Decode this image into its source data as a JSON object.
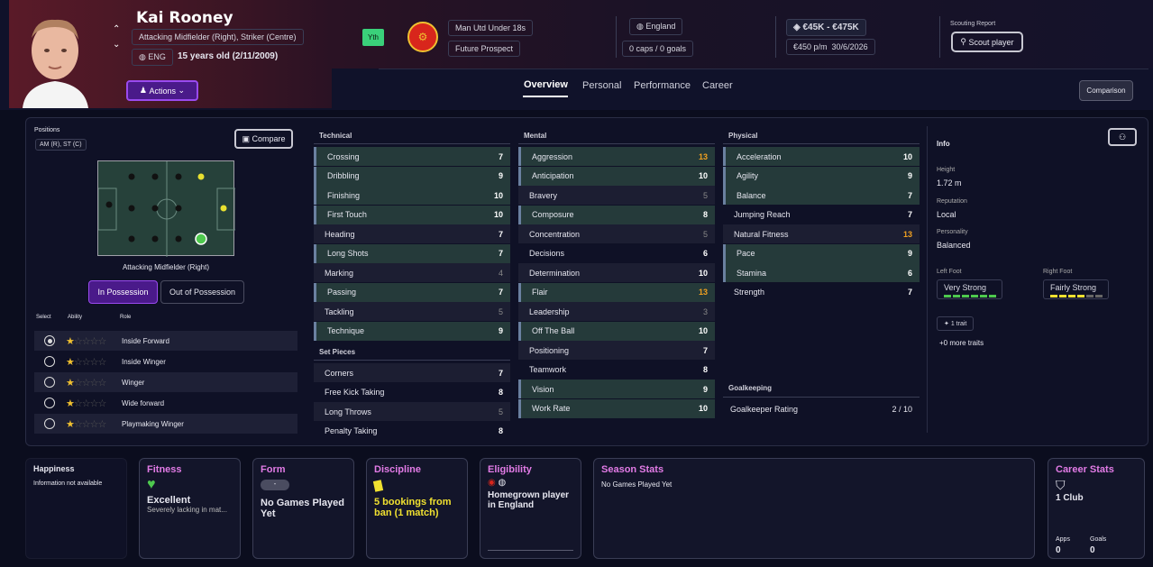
{
  "player": {
    "name": "Kai Rooney",
    "positions_long": "Attacking Midfielder (Right), Striker (Centre)",
    "nation": "ENG",
    "age": "15 years old (2/11/2009)",
    "badge": "Yth",
    "club": "Man Utd Under 18s",
    "status": "Future Prospect",
    "country": "England",
    "caps": "0 caps / 0 goals",
    "value": "€45K - €475K",
    "wage": "€450 p/m",
    "contract": "30/6/2026",
    "scout_label": "Scouting Report",
    "scout_btn": "Scout player",
    "actions": "Actions",
    "comparison": "Comparison"
  },
  "tabs": [
    "Overview",
    "Personal",
    "Performance",
    "Career"
  ],
  "left": {
    "positions_label": "Positions",
    "positions": "AM (R), ST (C)",
    "compare": "Compare",
    "role_caption": "Attacking Midfielder (Right)",
    "in_poss": "In Possession",
    "out_poss": "Out of Possession",
    "col_select": "Select",
    "col_ability": "Ability",
    "col_role": "Role",
    "roles": [
      {
        "name": "Inside Forward",
        "stars": 1
      },
      {
        "name": "Inside Winger",
        "stars": 1
      },
      {
        "name": "Winger",
        "stars": 1
      },
      {
        "name": "Wide forward",
        "stars": 0.5
      },
      {
        "name": "Playmaking Winger",
        "stars": 0.5
      }
    ]
  },
  "technical": {
    "title": "Technical",
    "items": [
      [
        "Crossing",
        "7"
      ],
      [
        "Dribbling",
        "9"
      ],
      [
        "Finishing",
        "10"
      ],
      [
        "First Touch",
        "10"
      ],
      [
        "Heading",
        "7"
      ],
      [
        "Long Shots",
        "7"
      ],
      [
        "Marking",
        "4"
      ],
      [
        "Passing",
        "7"
      ],
      [
        "Tackling",
        "5"
      ],
      [
        "Technique",
        "9"
      ]
    ]
  },
  "setpieces": {
    "title": "Set Pieces",
    "items": [
      [
        "Corners",
        "7"
      ],
      [
        "Free Kick Taking",
        "8"
      ],
      [
        "Long Throws",
        "5"
      ],
      [
        "Penalty Taking",
        "8"
      ]
    ]
  },
  "mental": {
    "title": "Mental",
    "items": [
      [
        "Aggression",
        "13"
      ],
      [
        "Anticipation",
        "10"
      ],
      [
        "Bravery",
        "5"
      ],
      [
        "Composure",
        "8"
      ],
      [
        "Concentration",
        "5"
      ],
      [
        "Decisions",
        "6"
      ],
      [
        "Determination",
        "10"
      ],
      [
        "Flair",
        "13"
      ],
      [
        "Leadership",
        "3"
      ],
      [
        "Off The Ball",
        "10"
      ],
      [
        "Positioning",
        "7"
      ],
      [
        "Teamwork",
        "8"
      ],
      [
        "Vision",
        "9"
      ],
      [
        "Work Rate",
        "10"
      ]
    ]
  },
  "physical": {
    "title": "Physical",
    "items": [
      [
        "Acceleration",
        "10"
      ],
      [
        "Agility",
        "9"
      ],
      [
        "Balance",
        "7"
      ],
      [
        "Jumping Reach",
        "7"
      ],
      [
        "Natural Fitness",
        "13"
      ],
      [
        "Pace",
        "9"
      ],
      [
        "Stamina",
        "6"
      ],
      [
        "Strength",
        "7"
      ]
    ]
  },
  "goalkeeping": {
    "title": "Goalkeeping",
    "label": "Goalkeeper Rating",
    "value": "2 / 10"
  },
  "info": {
    "title": "Info",
    "height_l": "Height",
    "height": "1.72 m",
    "rep_l": "Reputation",
    "rep": "Local",
    "pers_l": "Personality",
    "pers": "Balanced",
    "lf_l": "Left Foot",
    "lf": "Very Strong",
    "rf_l": "Right Foot",
    "rf": "Fairly Strong",
    "trait": "1 trait",
    "more": "+0 more traits"
  },
  "cards": {
    "happiness": "Happiness",
    "happiness_txt": "Information not available",
    "fitness": "Fitness",
    "fitness_v": "Excellent",
    "fitness_s": "Severely lacking in mat...",
    "form": "Form",
    "form_pill": "-",
    "form_v": "No Games Played Yet",
    "disc": "Discipline",
    "disc_v": "5 bookings from ban (1 match)",
    "elig": "Eligibility",
    "elig_v": "Homegrown player in England",
    "season": "Season Stats",
    "season_v": "No Games Played Yet",
    "career": "Career Stats",
    "career_v": "1 Club",
    "apps_l": "Apps",
    "apps": "0",
    "goals_l": "Goals",
    "goals": "0"
  },
  "colors": {
    "accent": "#7a2fd6",
    "green": "#4ec94e",
    "yellow": "#f0c030",
    "orange": "#f0a020"
  }
}
